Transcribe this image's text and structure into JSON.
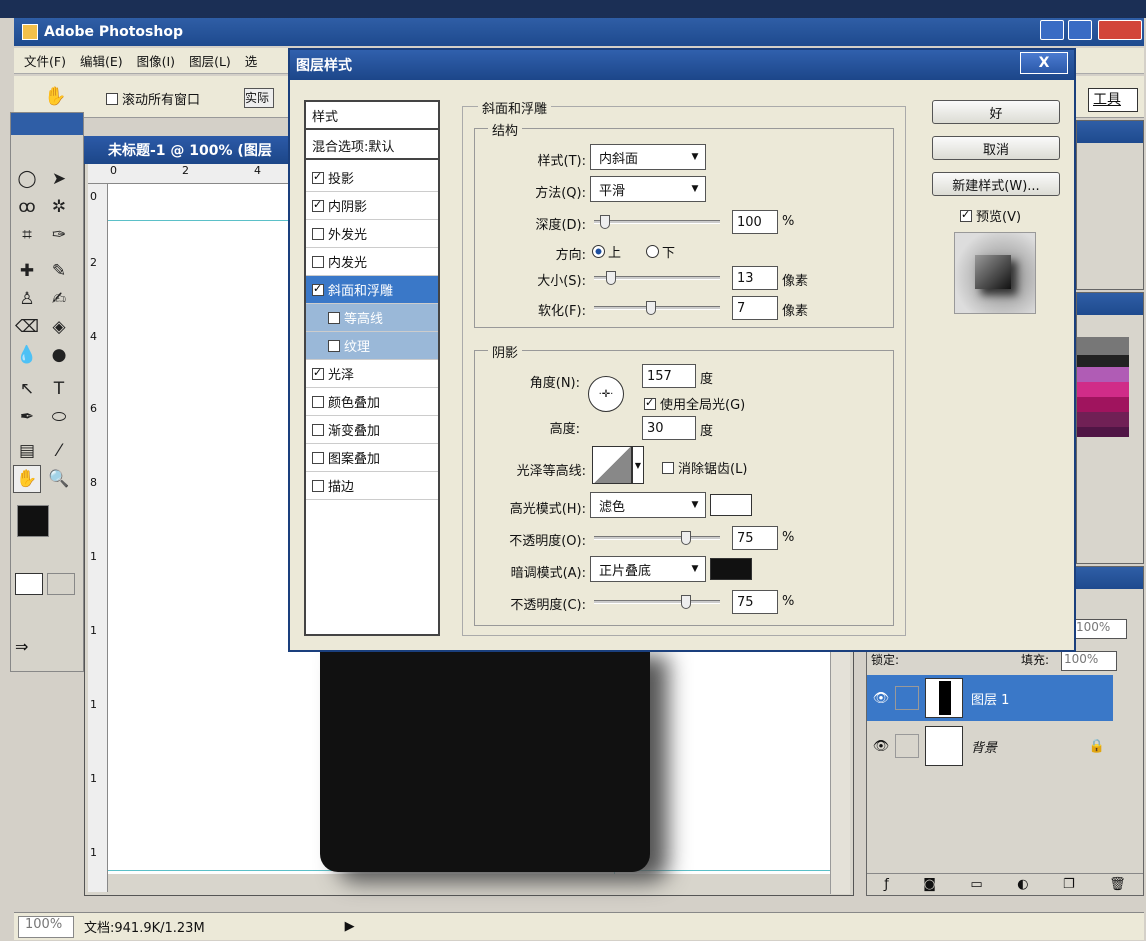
{
  "app": {
    "title": "Adobe Photoshop"
  },
  "menu": [
    "文件(F)",
    "编辑(E)",
    "图像(I)",
    "图层(L)",
    "选"
  ],
  "options": {
    "scroll_all": "滚动所有窗口",
    "actual": "实际",
    "tool_label": "工具"
  },
  "document": {
    "title": "未标题-1 @ 100% (图层",
    "ruler_h": [
      "0",
      "2",
      "4"
    ],
    "ruler_v": [
      "0",
      "2",
      "4",
      "6",
      "8",
      "1",
      "1",
      "1",
      "1",
      "1"
    ]
  },
  "status": {
    "zoom": "100%",
    "doc": "文档:941.9K/1.23M"
  },
  "layers": {
    "lock_label": "锁定:",
    "fill_label": "填充:",
    "fill_value": "100%",
    "opacity_value": "100%",
    "items": [
      {
        "name": "图层 1",
        "selected": true
      },
      {
        "name": "背景",
        "selected": false
      }
    ]
  },
  "dialog": {
    "title": "图层样式",
    "close": "X",
    "styles_header": "样式",
    "blend_options": "混合选项:默认",
    "style_items": [
      {
        "label": "投影",
        "checked": true
      },
      {
        "label": "内阴影",
        "checked": true
      },
      {
        "label": "外发光",
        "checked": false
      },
      {
        "label": "内发光",
        "checked": false
      },
      {
        "label": "斜面和浮雕",
        "checked": true,
        "selected": true
      },
      {
        "label": "等高线",
        "checked": false,
        "sub": true
      },
      {
        "label": "纹理",
        "checked": false,
        "sub": true
      },
      {
        "label": "光泽",
        "checked": true
      },
      {
        "label": "颜色叠加",
        "checked": false
      },
      {
        "label": "渐变叠加",
        "checked": false
      },
      {
        "label": "图案叠加",
        "checked": false
      },
      {
        "label": "描边",
        "checked": false
      }
    ],
    "bevel_title": "斜面和浮雕",
    "structure_title": "结构",
    "style_label": "样式(T):",
    "style_value": "内斜面",
    "technique_label": "方法(Q):",
    "technique_value": "平滑",
    "depth_label": "深度(D):",
    "depth_value": "100",
    "depth_unit": "%",
    "depth_pct": 0.05,
    "direction_label": "方向:",
    "dir_up": "上",
    "dir_down": "下",
    "size_label": "大小(S):",
    "size_value": "13",
    "size_unit": "像素",
    "size_pct": 0.1,
    "soften_label": "软化(F):",
    "soften_value": "7",
    "soften_unit": "像素",
    "soften_pct": 0.45,
    "shading_title": "阴影",
    "angle_label": "角度(N):",
    "angle_value": "157",
    "angle_unit": "度",
    "global_light": "使用全局光(G)",
    "altitude_label": "高度:",
    "altitude_value": "30",
    "altitude_unit": "度",
    "gloss_label": "光泽等高线:",
    "antialias": "消除锯齿(L)",
    "highlight_label": "高光模式(H):",
    "highlight_value": "滤色",
    "highlight_color": "#ffffff",
    "hl_opacity_label": "不透明度(O):",
    "hl_opacity_value": "75",
    "hl_opacity_unit": "%",
    "hl_opacity_pct": 0.75,
    "shadow_label": "暗调模式(A):",
    "shadow_value": "正片叠底",
    "shadow_color": "#111111",
    "sh_opacity_label": "不透明度(C):",
    "sh_opacity_value": "75",
    "sh_opacity_unit": "%",
    "sh_opacity_pct": 0.75,
    "ok": "好",
    "cancel": "取消",
    "new_style": "新建样式(W)...",
    "preview": "预览(V)"
  }
}
